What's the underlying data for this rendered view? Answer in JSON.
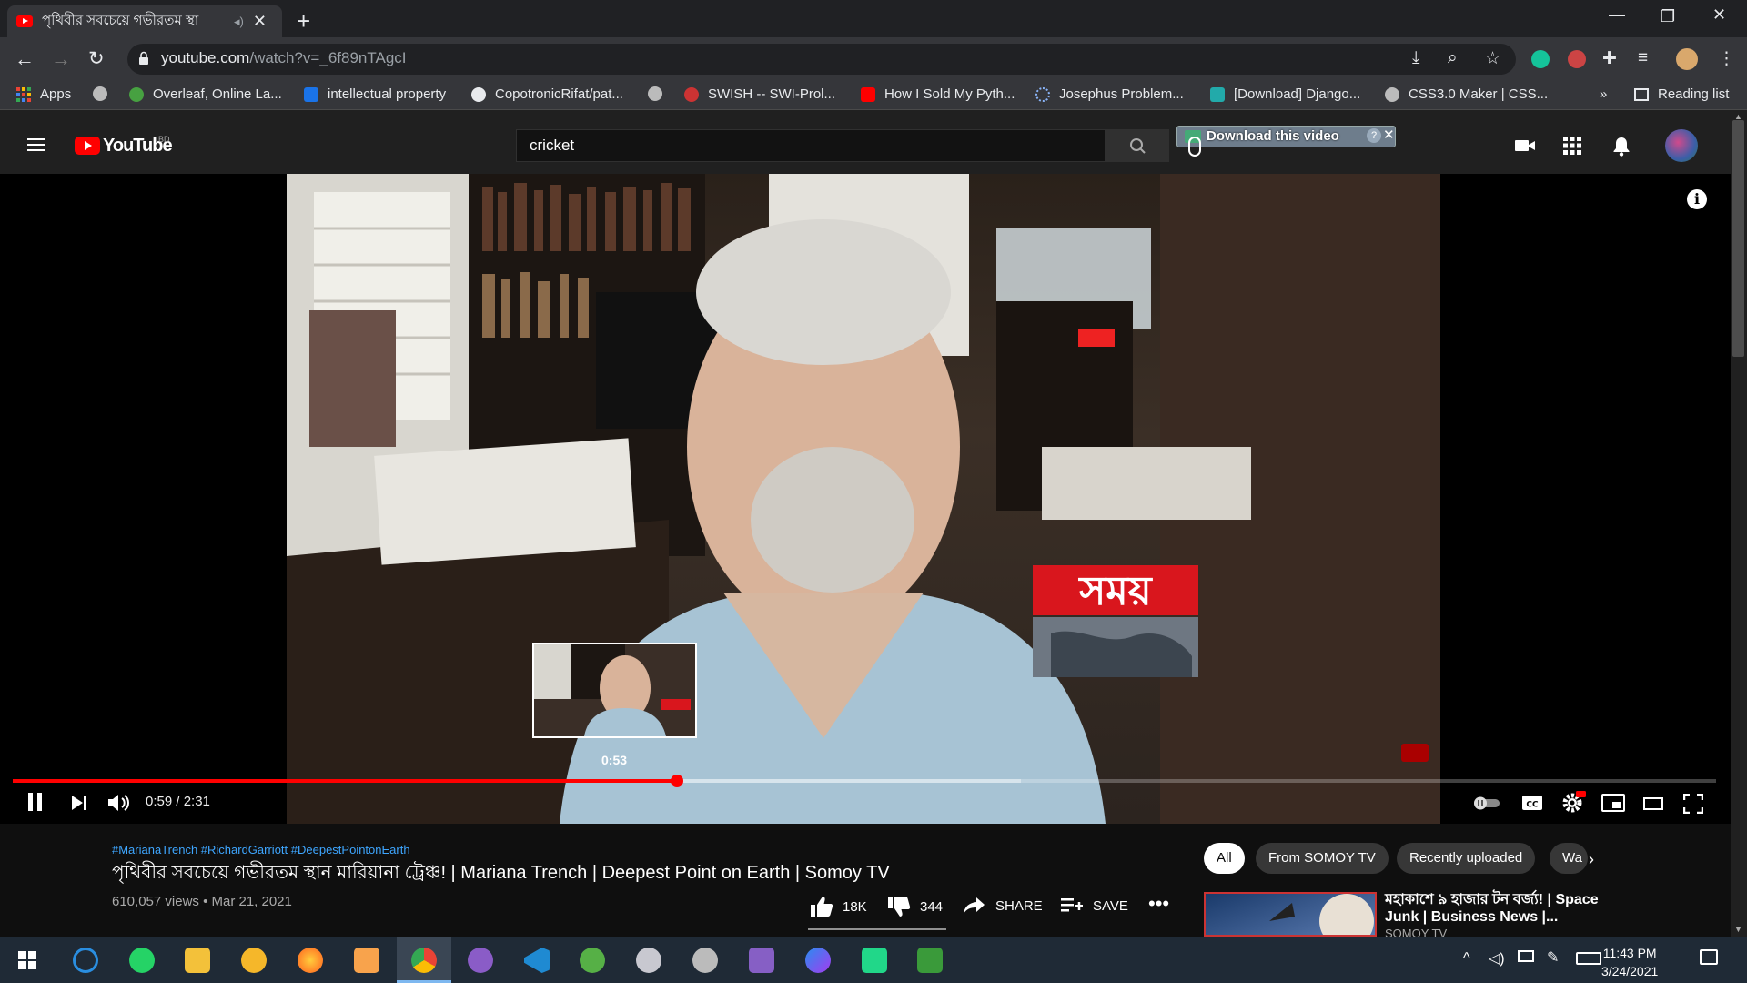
{
  "browser": {
    "tab_title": "পৃথিবীর সবচেয়ে গভীরতম স্থা",
    "url_main": "youtube.com",
    "url_path": "/watch?v=_6f89nTAgcI",
    "bookmarks": [
      {
        "label": "Apps"
      },
      {
        "label": ""
      },
      {
        "label": "Overleaf, Online La..."
      },
      {
        "label": "intellectual property"
      },
      {
        "label": "CopotronicRifat/pat..."
      },
      {
        "label": ""
      },
      {
        "label": "SWISH -- SWI-Prol..."
      },
      {
        "label": "How I Sold My Pyth..."
      },
      {
        "label": "Josephus Problem..."
      },
      {
        "label": "[Download] Django..."
      },
      {
        "label": "CSS3.0 Maker | CSS..."
      }
    ],
    "more": "»",
    "reading_list": "Reading list"
  },
  "youtube": {
    "logo_text": "YouTube",
    "country_code": "BD",
    "search_value": "cricket",
    "download_bar": "Download this video"
  },
  "player": {
    "current_time": "0:59",
    "duration": "2:31",
    "time_display": "0:59 / 2:31",
    "preview_time": "0:53",
    "played_fraction": 0.39,
    "watermark": "সময়"
  },
  "video": {
    "hashtags": "#MarianaTrench #RichardGarriott #DeepestPointonEarth",
    "title": "পৃথিবীর সবচেয়ে গভীরতম স্থান মারিয়ানা ট্রেঞ্চ! | Mariana Trench | Deepest Point on Earth | Somoy TV",
    "views_date": "610,057 views • Mar 21, 2021",
    "likes": "18K",
    "dislikes": "344",
    "share": "SHARE",
    "save": "SAVE"
  },
  "chips": [
    "All",
    "From SOMOY TV",
    "Recently uploaded",
    "Wa"
  ],
  "recommendation": {
    "title": "মহাকাশে ৯ হাজার টন বর্জ্য! | Space Junk | Business News |...",
    "channel": "SOMOY TV"
  },
  "taskbar": {
    "time": "11:43 PM",
    "date": "3/24/2021"
  }
}
